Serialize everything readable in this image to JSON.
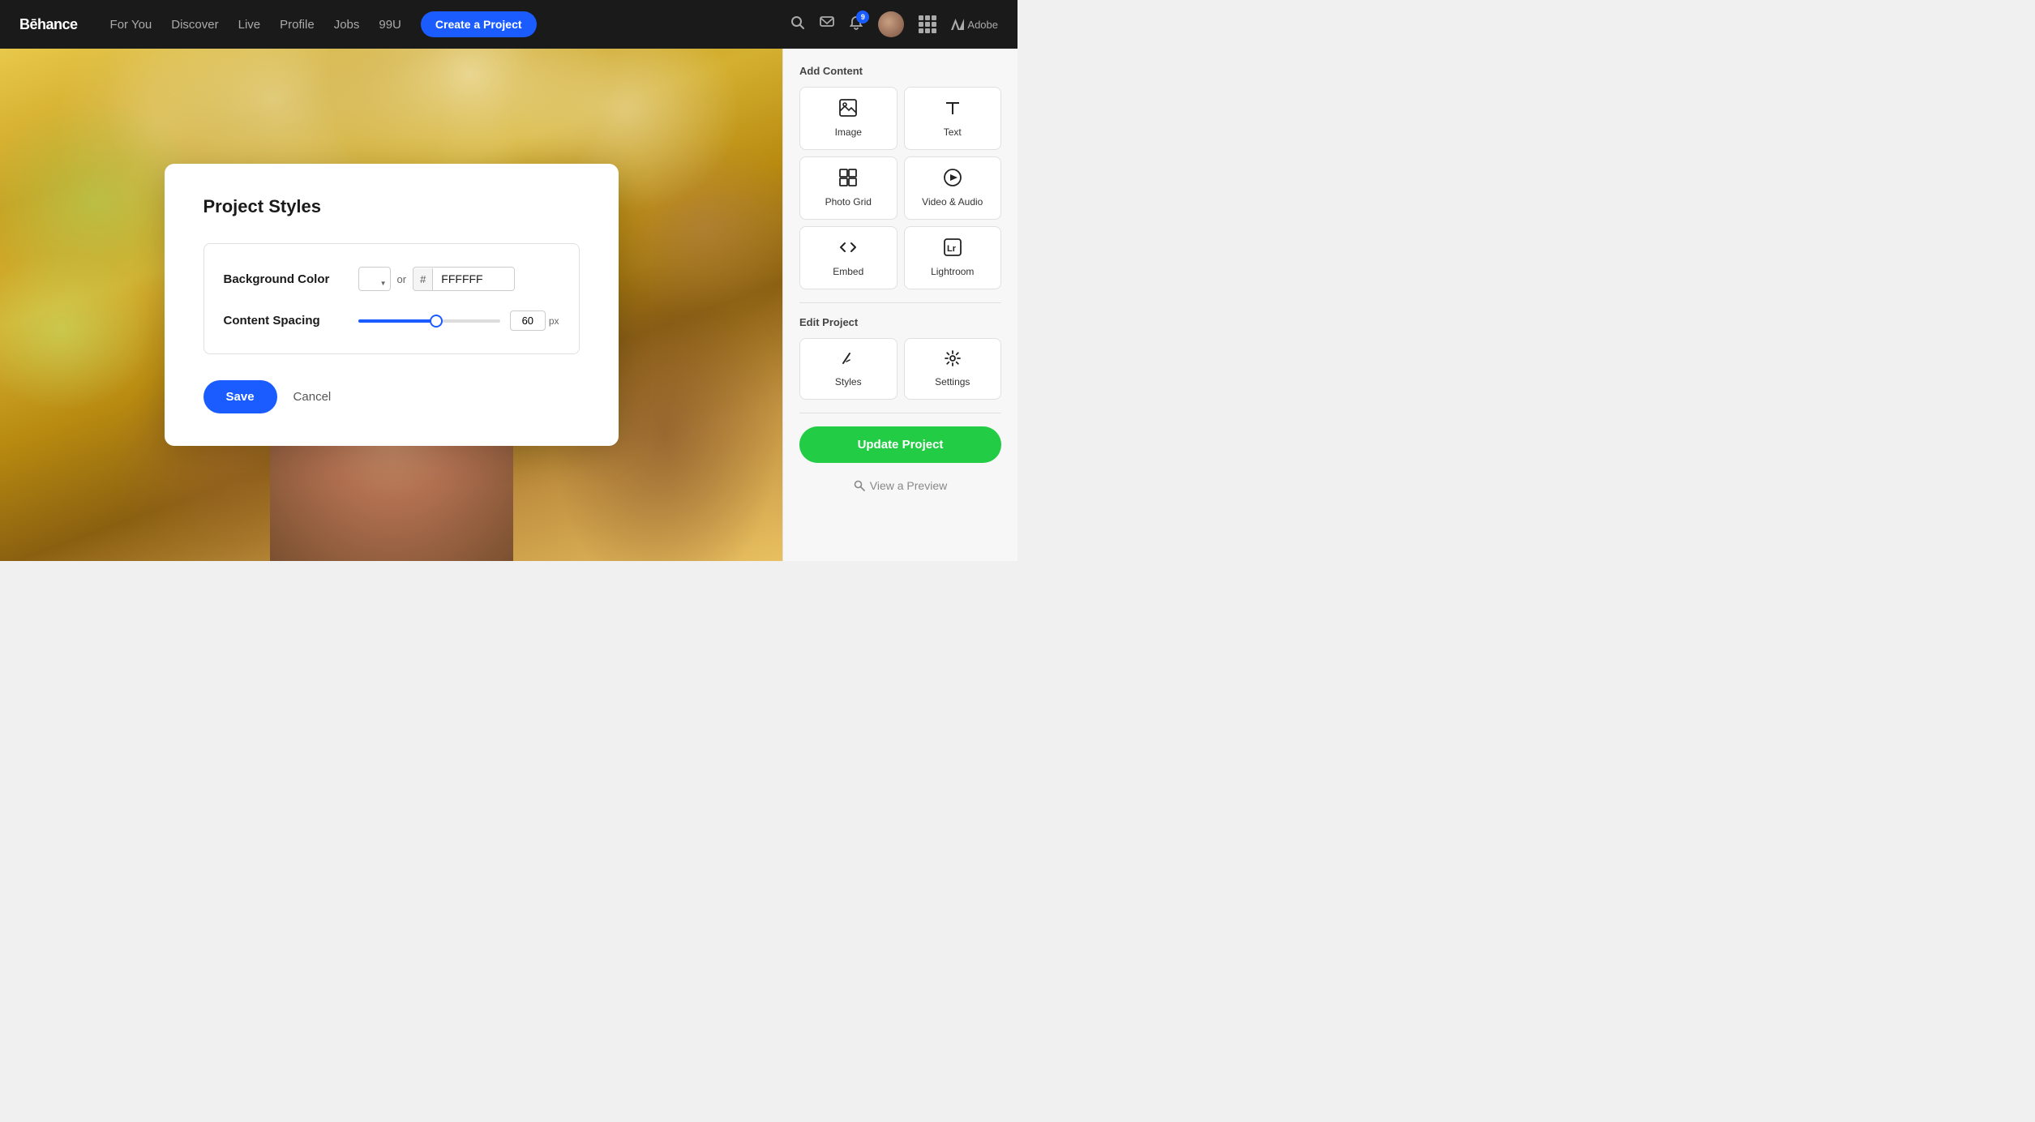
{
  "navbar": {
    "logo": "Bēhance",
    "links": [
      "For You",
      "Discover",
      "Live",
      "Profile",
      "Jobs",
      "99U"
    ],
    "cta": "Create a Project",
    "notification_count": "9",
    "adobe_label": "Adobe"
  },
  "modal": {
    "title": "Project Styles",
    "background_color_label": "Background Color",
    "bg_color_hex": "FFFFFF",
    "hex_hash": "#",
    "hex_value": "FFFFFF",
    "or_text": "or",
    "content_spacing_label": "Content Spacing",
    "slider_value": "60",
    "slider_unit": "px",
    "save_label": "Save",
    "cancel_label": "Cancel"
  },
  "sidebar": {
    "add_content_title": "Add Content",
    "items": [
      {
        "id": "image",
        "label": "Image",
        "icon": "image-icon"
      },
      {
        "id": "text",
        "label": "Text",
        "icon": "text-icon"
      },
      {
        "id": "photo-grid",
        "label": "Photo Grid",
        "icon": "photo-grid-icon"
      },
      {
        "id": "video-audio",
        "label": "Video & Audio",
        "icon": "video-icon"
      },
      {
        "id": "embed",
        "label": "Embed",
        "icon": "embed-icon"
      },
      {
        "id": "lightroom",
        "label": "Lightroom",
        "icon": "lightroom-icon"
      }
    ],
    "edit_project_title": "Edit Project",
    "edit_items": [
      {
        "id": "styles",
        "label": "Styles",
        "icon": "styles-icon"
      },
      {
        "id": "settings",
        "label": "Settings",
        "icon": "settings-icon"
      }
    ],
    "update_button": "Update Project",
    "preview_label": "View a Preview"
  }
}
